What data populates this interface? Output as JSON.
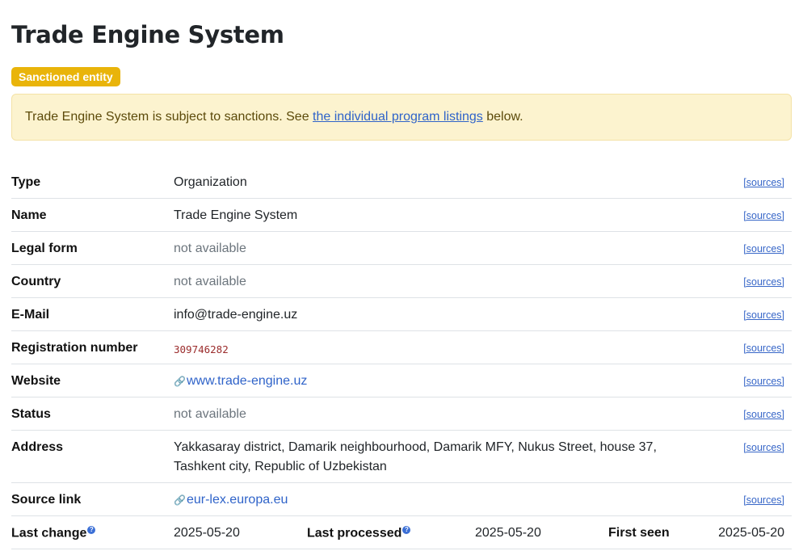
{
  "title": "Trade Engine System",
  "badge": "Sanctioned entity",
  "alert": {
    "text_before": "Trade Engine System is subject to sanctions. See ",
    "link_text": "the individual program listings",
    "text_after": " below."
  },
  "sources_label": "[sources]",
  "facts": {
    "type": {
      "label": "Type",
      "value": "Organization"
    },
    "name": {
      "label": "Name",
      "value": "Trade Engine System"
    },
    "legal_form": {
      "label": "Legal form",
      "value": "not available"
    },
    "country": {
      "label": "Country",
      "value": "not available"
    },
    "email": {
      "label": "E-Mail",
      "value": "info@trade-engine.uz"
    },
    "registration": {
      "label": "Registration number",
      "value": "309746282"
    },
    "website": {
      "label": "Website",
      "value": "www.trade-engine.uz"
    },
    "status": {
      "label": "Status",
      "value": "not available"
    },
    "address": {
      "label": "Address",
      "line1": "Yakkasaray district, Damarik neighbourhood, Damarik MFY, Nukus Street, house 37,",
      "line2": "Tashkent city, Republic of Uzbekistan"
    },
    "source_link": {
      "label": "Source link",
      "value": "eur-lex.europa.eu"
    }
  },
  "meta": {
    "last_change_label": "Last change",
    "last_change": "2025-05-20",
    "last_processed_label": "Last processed",
    "last_processed": "2025-05-20",
    "first_seen_label": "First seen",
    "first_seen": "2025-05-20"
  },
  "icons": {
    "link": "link-icon",
    "help": "help-icon"
  },
  "colors": {
    "badge": "#e9b40a",
    "alert_bg": "#fcf3cf",
    "link": "#2f63c9"
  }
}
